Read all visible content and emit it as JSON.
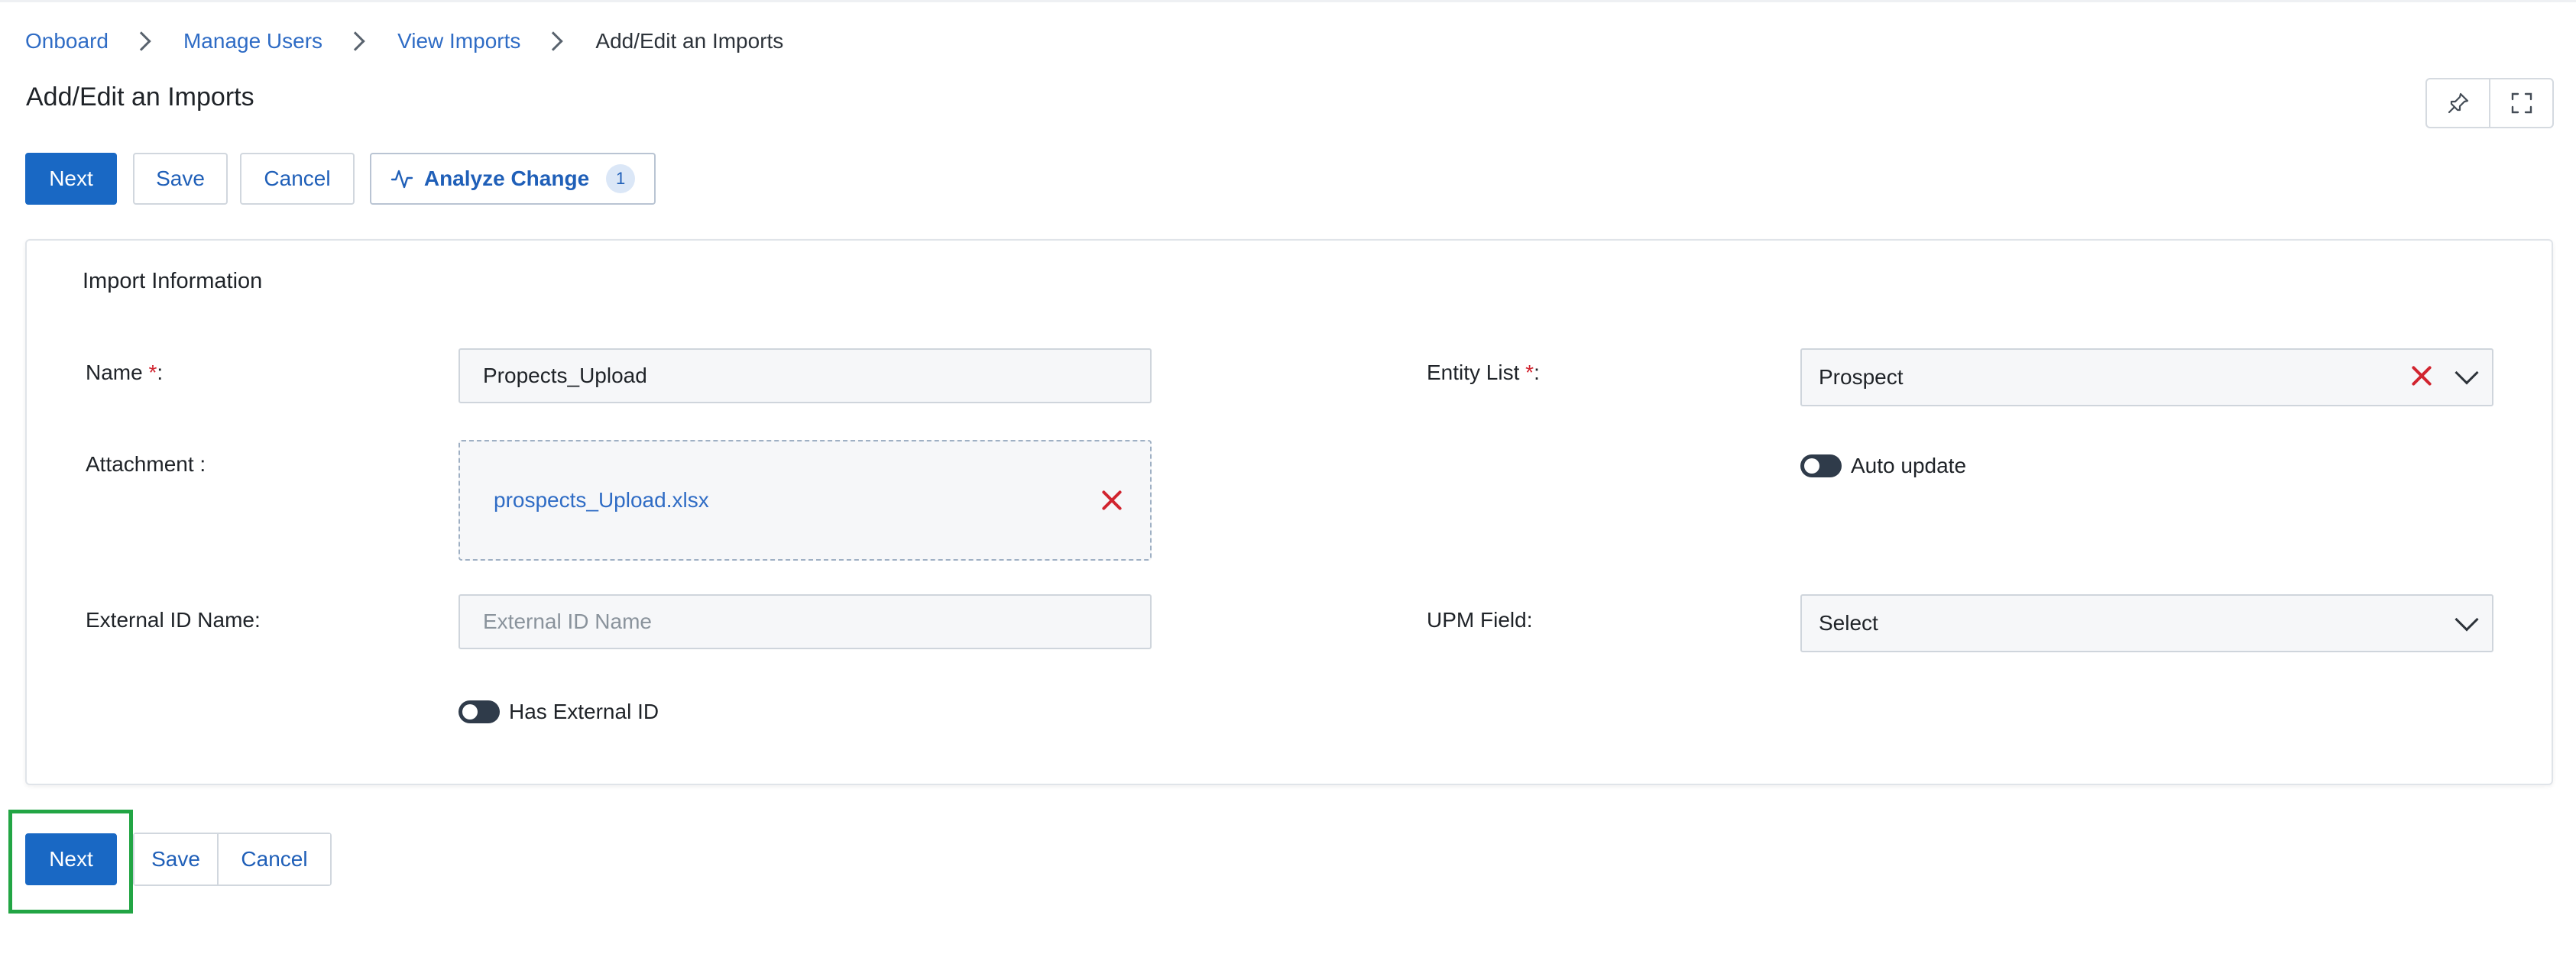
{
  "breadcrumb": {
    "items": [
      "Onboard",
      "Manage Users",
      "View Imports"
    ],
    "current": "Add/Edit an Imports"
  },
  "page_title": "Add/Edit an Imports",
  "toolbar": {
    "next_label": "Next",
    "save_label": "Save",
    "cancel_label": "Cancel",
    "analyze_label": "Analyze Change",
    "analyze_count": "1"
  },
  "icons": {
    "pin": "pin-icon",
    "fullscreen": "fullscreen-icon",
    "analyze": "activity-icon",
    "clear": "close-icon",
    "dropdown": "chevron-down-icon"
  },
  "form": {
    "section_title": "Import Information",
    "name": {
      "label": "Name ",
      "required": "*",
      "suffix": ":",
      "value": "Propects_Upload"
    },
    "attachment": {
      "label": "Attachment :",
      "file_name": "prospects_Upload.xlsx"
    },
    "external_id": {
      "label": "External ID Name:",
      "value": "",
      "placeholder": "External ID Name"
    },
    "has_external_id": {
      "label": "Has External ID",
      "enabled": false
    },
    "entity_list": {
      "label": "Entity List ",
      "required": "*",
      "suffix": ":",
      "value": "Prospect"
    },
    "auto_update": {
      "label": "Auto update",
      "enabled": false
    },
    "upm_field": {
      "label": "UPM Field:",
      "value": "Select"
    }
  },
  "footer": {
    "next_label": "Next",
    "save_label": "Save",
    "cancel_label": "Cancel"
  },
  "colors": {
    "primary": "#1968c4",
    "link": "#2f6cc5",
    "required": "#d1242f",
    "highlight": "#22a544"
  }
}
